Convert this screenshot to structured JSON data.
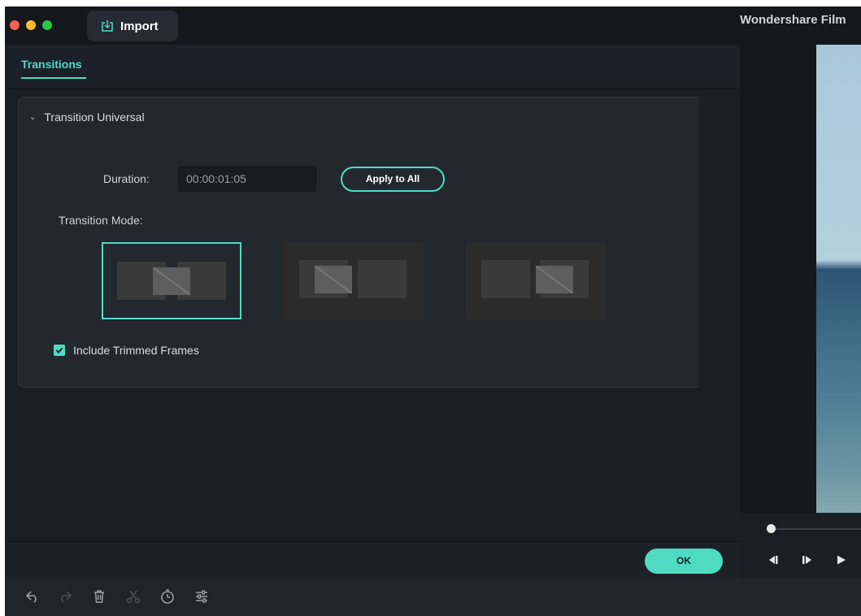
{
  "titlebar": {
    "import_label": "Import",
    "app_title": "Wondershare Film"
  },
  "tabs": [
    {
      "label": "Transitions",
      "active": true
    }
  ],
  "section": {
    "title": "Transition Universal",
    "duration_label": "Duration:",
    "duration_value": "00:00:01:05",
    "apply_all_label": "Apply to All",
    "mode_label": "Transition Mode:",
    "modes": [
      {
        "name": "overlap",
        "selected": true
      },
      {
        "name": "prefix",
        "selected": false
      },
      {
        "name": "postfix",
        "selected": false
      }
    ],
    "include_trimmed_label": "Include Trimmed Frames",
    "include_trimmed_checked": true
  },
  "footer": {
    "ok_label": "OK"
  },
  "toolbar_icons": [
    "undo-icon",
    "redo-icon",
    "delete-icon",
    "cut-icon",
    "speed-icon",
    "adjust-icon"
  ],
  "player_icons": [
    "prev-frame-icon",
    "next-frame-icon",
    "play-icon"
  ],
  "colors": {
    "accent": "#4fdbc2",
    "background": "#1c2027"
  }
}
